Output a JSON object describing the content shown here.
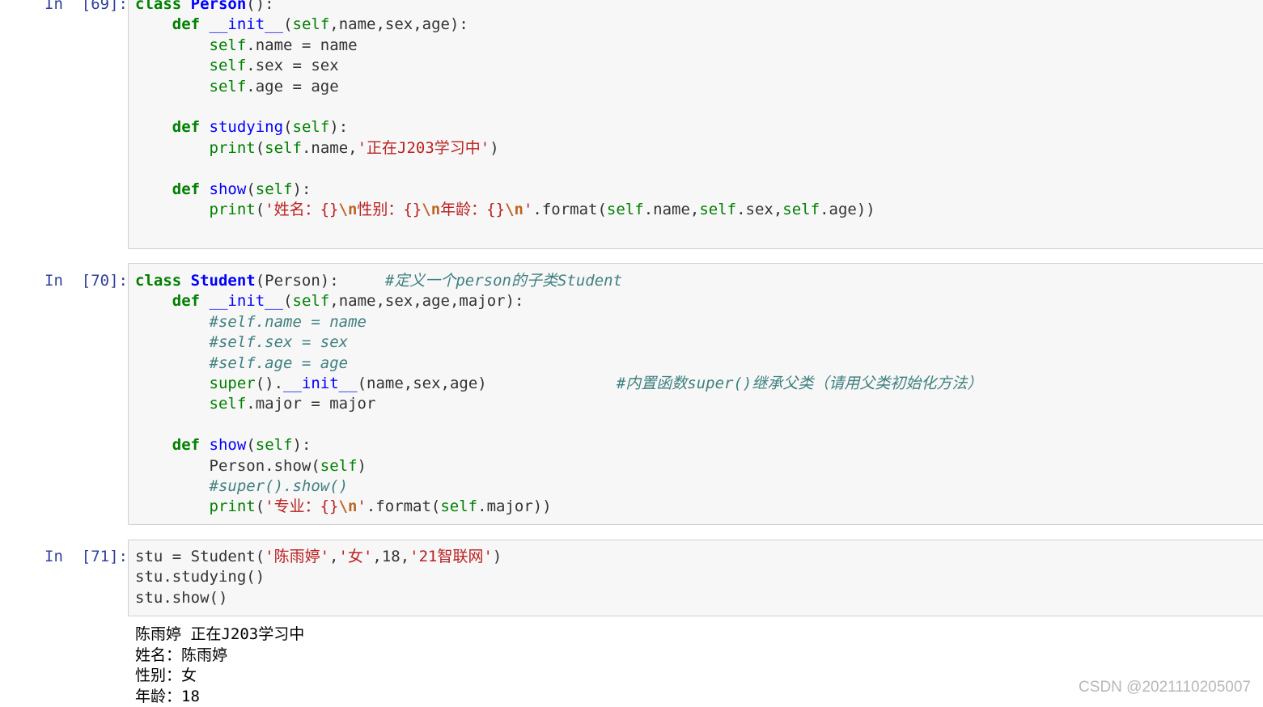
{
  "cells": [
    {
      "prompt": "In  [69]:",
      "lines": [
        [
          [
            "kw",
            "class"
          ],
          [
            "nm",
            " "
          ],
          [
            "cls",
            "Person"
          ],
          [
            "nm",
            "():"
          ]
        ],
        [
          [
            "nm",
            "    "
          ],
          [
            "kw",
            "def"
          ],
          [
            "nm",
            " "
          ],
          [
            "fn",
            "__init__"
          ],
          [
            "nm",
            "("
          ],
          [
            "self",
            "self"
          ],
          [
            "nm",
            ",name,sex,age):"
          ]
        ],
        [
          [
            "nm",
            "        "
          ],
          [
            "self",
            "self"
          ],
          [
            "nm",
            ".name = name"
          ]
        ],
        [
          [
            "nm",
            "        "
          ],
          [
            "self",
            "self"
          ],
          [
            "nm",
            ".sex = sex"
          ]
        ],
        [
          [
            "nm",
            "        "
          ],
          [
            "self",
            "self"
          ],
          [
            "nm",
            ".age = age"
          ]
        ],
        [
          [
            "nm",
            " "
          ]
        ],
        [
          [
            "nm",
            "    "
          ],
          [
            "kw",
            "def"
          ],
          [
            "nm",
            " "
          ],
          [
            "fn",
            "studying"
          ],
          [
            "nm",
            "("
          ],
          [
            "self",
            "self"
          ],
          [
            "nm",
            "):"
          ]
        ],
        [
          [
            "nm",
            "        "
          ],
          [
            "bi",
            "print"
          ],
          [
            "nm",
            "("
          ],
          [
            "self",
            "self"
          ],
          [
            "nm",
            ".name,"
          ],
          [
            "str",
            "'正在J203学习中'"
          ],
          [
            "nm",
            ")"
          ]
        ],
        [
          [
            "nm",
            " "
          ]
        ],
        [
          [
            "nm",
            "    "
          ],
          [
            "kw",
            "def"
          ],
          [
            "nm",
            " "
          ],
          [
            "fn",
            "show"
          ],
          [
            "nm",
            "("
          ],
          [
            "self",
            "self"
          ],
          [
            "nm",
            "):"
          ]
        ],
        [
          [
            "nm",
            "        "
          ],
          [
            "bi",
            "print"
          ],
          [
            "nm",
            "("
          ],
          [
            "str",
            "'姓名：{}"
          ],
          [
            "esc",
            "\\n"
          ],
          [
            "str",
            "性别：{}"
          ],
          [
            "esc",
            "\\n"
          ],
          [
            "str",
            "年龄：{}"
          ],
          [
            "esc",
            "\\n"
          ],
          [
            "str",
            "'"
          ],
          [
            "nm",
            ".format("
          ],
          [
            "self",
            "self"
          ],
          [
            "nm",
            ".name,"
          ],
          [
            "self",
            "self"
          ],
          [
            "nm",
            ".sex,"
          ],
          [
            "self",
            "self"
          ],
          [
            "nm",
            ".age))"
          ]
        ]
      ]
    },
    {
      "prompt": "In  [70]:",
      "lines": [
        [
          [
            "kw",
            "class"
          ],
          [
            "nm",
            " "
          ],
          [
            "cls",
            "Student"
          ],
          [
            "nm",
            "(Person):     "
          ],
          [
            "cm",
            "#定义一个person的子类Student"
          ]
        ],
        [
          [
            "nm",
            "    "
          ],
          [
            "kw",
            "def"
          ],
          [
            "nm",
            " "
          ],
          [
            "fn",
            "__init__"
          ],
          [
            "nm",
            "("
          ],
          [
            "self",
            "self"
          ],
          [
            "nm",
            ",name,sex,age,major):"
          ]
        ],
        [
          [
            "nm",
            "        "
          ],
          [
            "cm",
            "#self.name = name"
          ]
        ],
        [
          [
            "nm",
            "        "
          ],
          [
            "cm",
            "#self.sex = sex"
          ]
        ],
        [
          [
            "nm",
            "        "
          ],
          [
            "cm",
            "#self.age = age"
          ]
        ],
        [
          [
            "nm",
            "        "
          ],
          [
            "bi",
            "super"
          ],
          [
            "nm",
            "()."
          ],
          [
            "fn",
            "__init__"
          ],
          [
            "nm",
            "(name,sex,age)              "
          ],
          [
            "cm",
            "#内置函数super()继承父类（请用父类初始化方法）"
          ]
        ],
        [
          [
            "nm",
            "        "
          ],
          [
            "self",
            "self"
          ],
          [
            "nm",
            ".major = major"
          ]
        ],
        [
          [
            "nm",
            " "
          ]
        ],
        [
          [
            "nm",
            "    "
          ],
          [
            "kw",
            "def"
          ],
          [
            "nm",
            " "
          ],
          [
            "fn",
            "show"
          ],
          [
            "nm",
            "("
          ],
          [
            "self",
            "self"
          ],
          [
            "nm",
            "):"
          ]
        ],
        [
          [
            "nm",
            "        Person.show("
          ],
          [
            "self",
            "self"
          ],
          [
            "nm",
            ")"
          ]
        ],
        [
          [
            "nm",
            "        "
          ],
          [
            "cm",
            "#super().show()"
          ]
        ],
        [
          [
            "nm",
            "        "
          ],
          [
            "bi",
            "print"
          ],
          [
            "nm",
            "("
          ],
          [
            "str",
            "'专业：{}"
          ],
          [
            "esc",
            "\\n"
          ],
          [
            "str",
            "'"
          ],
          [
            "nm",
            ".format("
          ],
          [
            "self",
            "self"
          ],
          [
            "nm",
            ".major))"
          ]
        ]
      ]
    },
    {
      "prompt": "In  [71]:",
      "lines": [
        [
          [
            "nm",
            "stu = Student("
          ],
          [
            "str",
            "'陈雨婷'"
          ],
          [
            "nm",
            ","
          ],
          [
            "str",
            "'女'"
          ],
          [
            "nm",
            ",18,"
          ],
          [
            "str",
            "'21智联网'"
          ],
          [
            "nm",
            ")"
          ]
        ],
        [
          [
            "nm",
            "stu.studying()"
          ]
        ],
        [
          [
            "nm",
            "stu.show()"
          ]
        ]
      ],
      "output": [
        "陈雨婷 正在J203学习中",
        "姓名：陈雨婷",
        "性别：女",
        "年龄：18"
      ]
    }
  ],
  "watermark": "CSDN @2021110205007"
}
